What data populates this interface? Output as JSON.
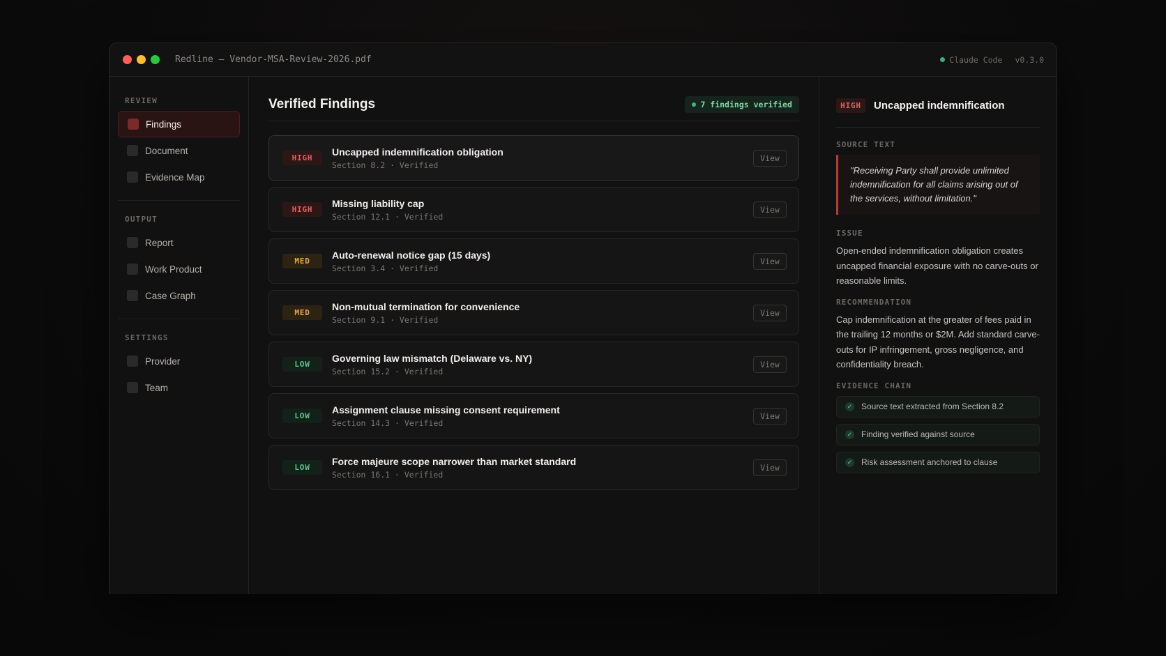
{
  "window": {
    "title": "Redline — Vendor-MSA-Review-2026.pdf",
    "status_label": "Claude Code",
    "version": "v0.3.0"
  },
  "sidebar": {
    "sections": [
      {
        "label": "REVIEW",
        "items": [
          {
            "label": "Findings",
            "active": true
          },
          {
            "label": "Document"
          },
          {
            "label": "Evidence Map"
          }
        ]
      },
      {
        "label": "OUTPUT",
        "items": [
          {
            "label": "Report"
          },
          {
            "label": "Work Product"
          },
          {
            "label": "Case Graph"
          }
        ]
      },
      {
        "label": "SETTINGS",
        "items": [
          {
            "label": "Provider"
          },
          {
            "label": "Team"
          }
        ]
      }
    ]
  },
  "main": {
    "title": "Verified Findings",
    "badge": "7 findings verified",
    "view_label": "View",
    "findings": [
      {
        "severity": "HIGH",
        "title": "Uncapped indemnification obligation",
        "meta": "Section 8.2 · Verified"
      },
      {
        "severity": "HIGH",
        "title": "Missing liability cap",
        "meta": "Section 12.1 · Verified"
      },
      {
        "severity": "MED",
        "title": "Auto-renewal notice gap (15 days)",
        "meta": "Section 3.4 · Verified"
      },
      {
        "severity": "MED",
        "title": "Non-mutual termination for convenience",
        "meta": "Section 9.1 · Verified"
      },
      {
        "severity": "LOW",
        "title": "Governing law mismatch (Delaware vs. NY)",
        "meta": "Section 15.2 · Verified"
      },
      {
        "severity": "LOW",
        "title": "Assignment clause missing consent requirement",
        "meta": "Section 14.3 · Verified"
      },
      {
        "severity": "LOW",
        "title": "Force majeure scope narrower than market standard",
        "meta": "Section 16.1 · Verified"
      }
    ]
  },
  "detail": {
    "severity": "HIGH",
    "title": "Uncapped indemnification",
    "source_label": "SOURCE TEXT",
    "source_text": "\"Receiving Party shall provide unlimited indemnification for all claims arising out of the services, without limitation.\"",
    "issue_label": "ISSUE",
    "issue_text": "Open-ended indemnification obligation creates uncapped financial exposure with no carve-outs or reasonable limits.",
    "recommendation_label": "RECOMMENDATION",
    "recommendation_text": "Cap indemnification at the greater of fees paid in the trailing 12 months or $2M. Add standard carve-outs for IP infringement, gross negligence, and confidentiality breach.",
    "evidence_label": "EVIDENCE CHAIN",
    "evidence": [
      "Source text extracted from Section 8.2",
      "Finding verified against source",
      "Risk assessment anchored to clause"
    ]
  },
  "colors": {
    "high": "#e0615e",
    "med": "#e8a64a",
    "low": "#5fc48c",
    "accent": "#b83a36"
  }
}
